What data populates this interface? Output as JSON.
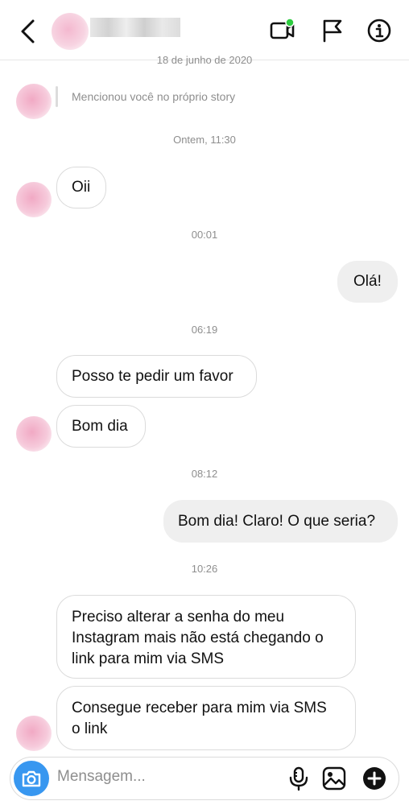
{
  "header": {
    "back_icon": "chevron-left-icon",
    "video_icon": "video-call-icon",
    "flag_icon": "flag-icon",
    "info_icon": "info-icon",
    "online_color": "#2ecc40"
  },
  "thread": {
    "top_date": "18 de junho de 2020",
    "story_mention": "Mencionou você no próprio story",
    "time_1": "Ontem, 11:30",
    "msg_1": "Oii",
    "time_2": "00:01",
    "msg_2": "Olá!",
    "time_3": "06:19",
    "msg_3": "Posso te pedir um favor",
    "msg_4": "Bom dia",
    "time_4": "08:12",
    "msg_5": "Bom dia! Claro! O que seria?",
    "time_5": "10:26",
    "msg_6_line1": "Preciso alterar a senha do meu",
    "msg_6_line2": "Instagram mais não está chegando o",
    "msg_6_line3": "link para mim via SMS",
    "msg_7_line1": "Consegue receber para mim via SMS",
    "msg_7_line2": "o link"
  },
  "composer": {
    "placeholder": "Mensagem...",
    "camera_icon": "camera-icon",
    "mic_icon": "microphone-icon",
    "gallery_icon": "gallery-icon",
    "plus_icon": "plus-icon",
    "accent": "#3897f0"
  }
}
